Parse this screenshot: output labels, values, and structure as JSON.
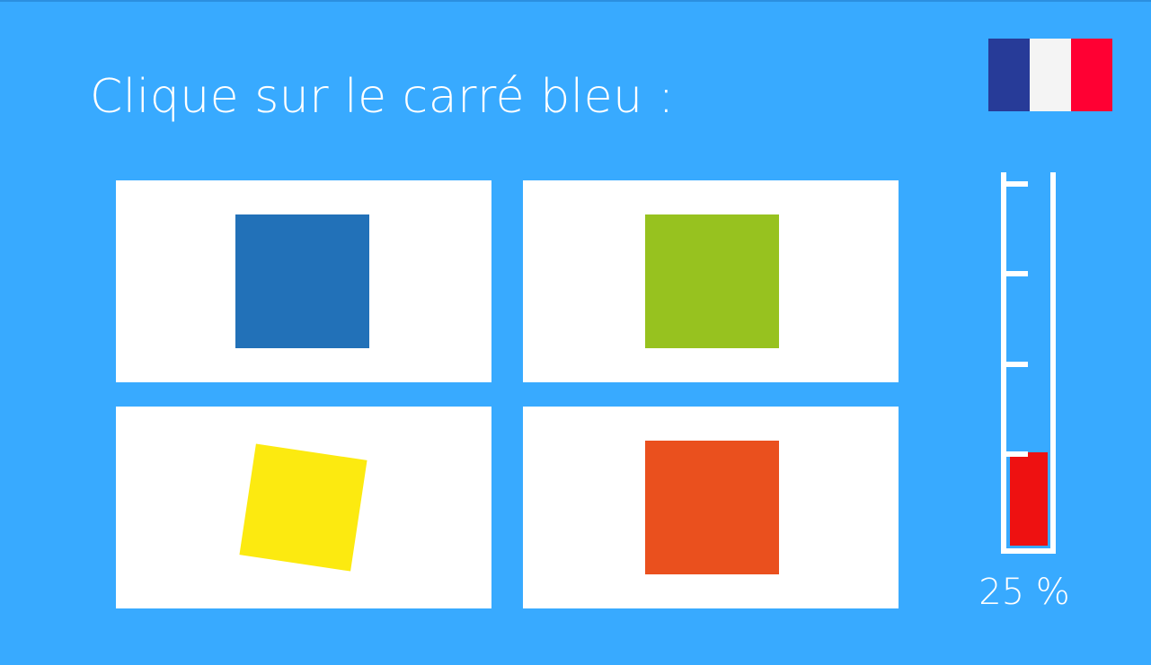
{
  "instruction": "Clique sur le carré bleu :",
  "language_flag": {
    "icon": "france-flag-icon",
    "colors": [
      "#273b98",
      "#f4f4f4",
      "#ff0033"
    ]
  },
  "choices": [
    {
      "name": "bleu",
      "color": "#2271b8"
    },
    {
      "name": "vert",
      "color": "#97c21f"
    },
    {
      "name": "jaune",
      "color": "#fcea10"
    },
    {
      "name": "orange",
      "color": "#ea501e"
    }
  ],
  "progress": {
    "value": 25,
    "label": "25 %",
    "fill_color": "#ee1111"
  },
  "colors": {
    "background": "#38aaff",
    "card": "#ffffff"
  }
}
